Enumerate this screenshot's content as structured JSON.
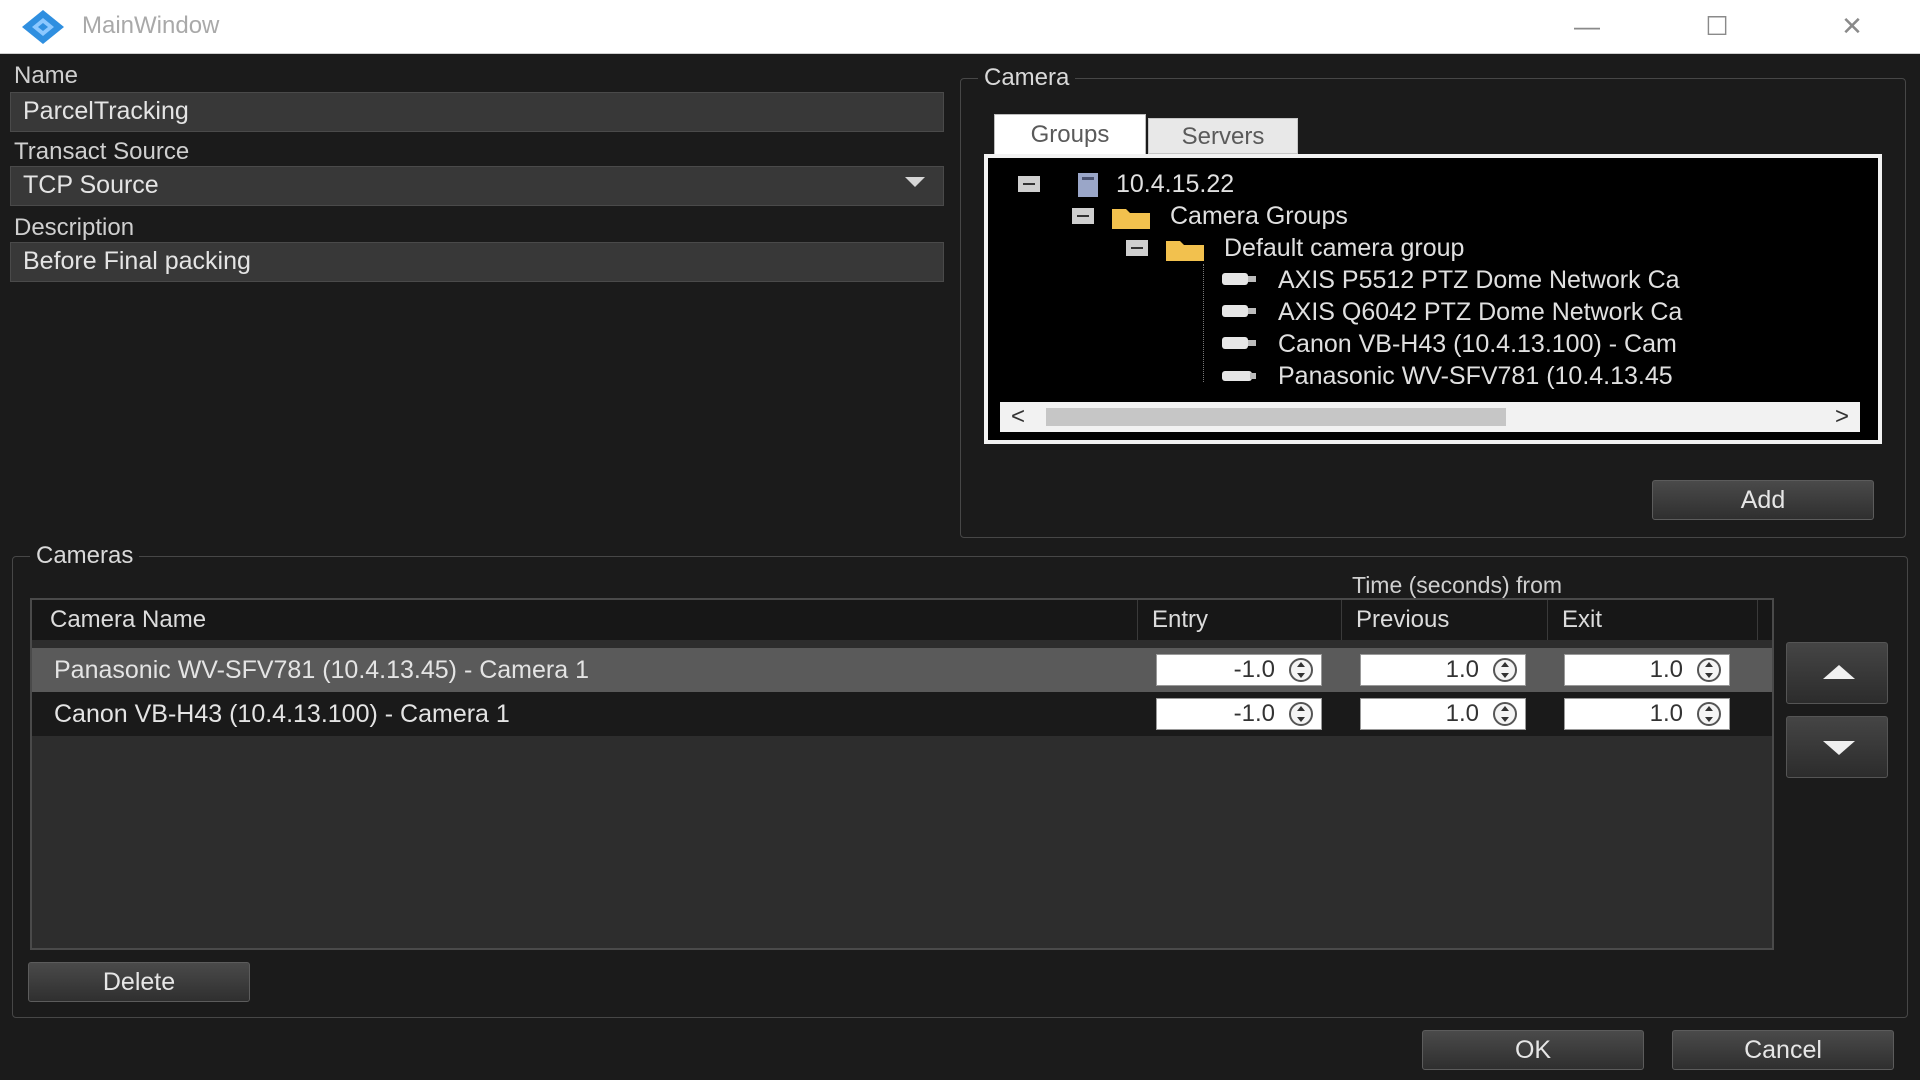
{
  "window": {
    "title": "MainWindow",
    "controls": {
      "minimize": "—",
      "maximize": "☐",
      "close": "✕"
    }
  },
  "form": {
    "name_label": "Name",
    "name_value": "ParcelTracking",
    "source_label": "Transact Source",
    "source_value": "TCP Source",
    "description_label": "Description",
    "description_value": "Before Final packing"
  },
  "camera_panel": {
    "title": "Camera",
    "tabs": [
      "Groups",
      "Servers"
    ],
    "active_tab": "Groups",
    "tree": {
      "server": "10.4.15.22",
      "group_root": "Camera Groups",
      "group": "Default camera group",
      "cameras": [
        "AXIS P5512 PTZ Dome Network Ca",
        "AXIS Q6042 PTZ Dome Network Ca",
        "Canon VB-H43 (10.4.13.100) - Cam",
        "Panasonic WV-SFV781 (10.4.13.45"
      ]
    },
    "scroll_left": "<",
    "scroll_right": ">",
    "add_label": "Add"
  },
  "cameras_panel": {
    "title": "Cameras",
    "time_caption": "Time (seconds) from",
    "columns": [
      "Camera Name",
      "Entry",
      "Previous",
      "Exit"
    ],
    "rows": [
      {
        "name": "Panasonic WV-SFV781 (10.4.13.45) - Camera 1",
        "entry": "-1.0",
        "previous": "1.0",
        "exit": "1.0",
        "selected": true
      },
      {
        "name": "Canon VB-H43 (10.4.13.100) - Camera 1",
        "entry": "-1.0",
        "previous": "1.0",
        "exit": "1.0",
        "selected": false
      }
    ],
    "delete_label": "Delete"
  },
  "footer": {
    "ok_label": "OK",
    "cancel_label": "Cancel"
  },
  "colors": {
    "background": "#1b1b1b",
    "selected_row": "#5a5a5a",
    "tree_bg": "#000000",
    "accent_icon": "#2f8fe0"
  }
}
